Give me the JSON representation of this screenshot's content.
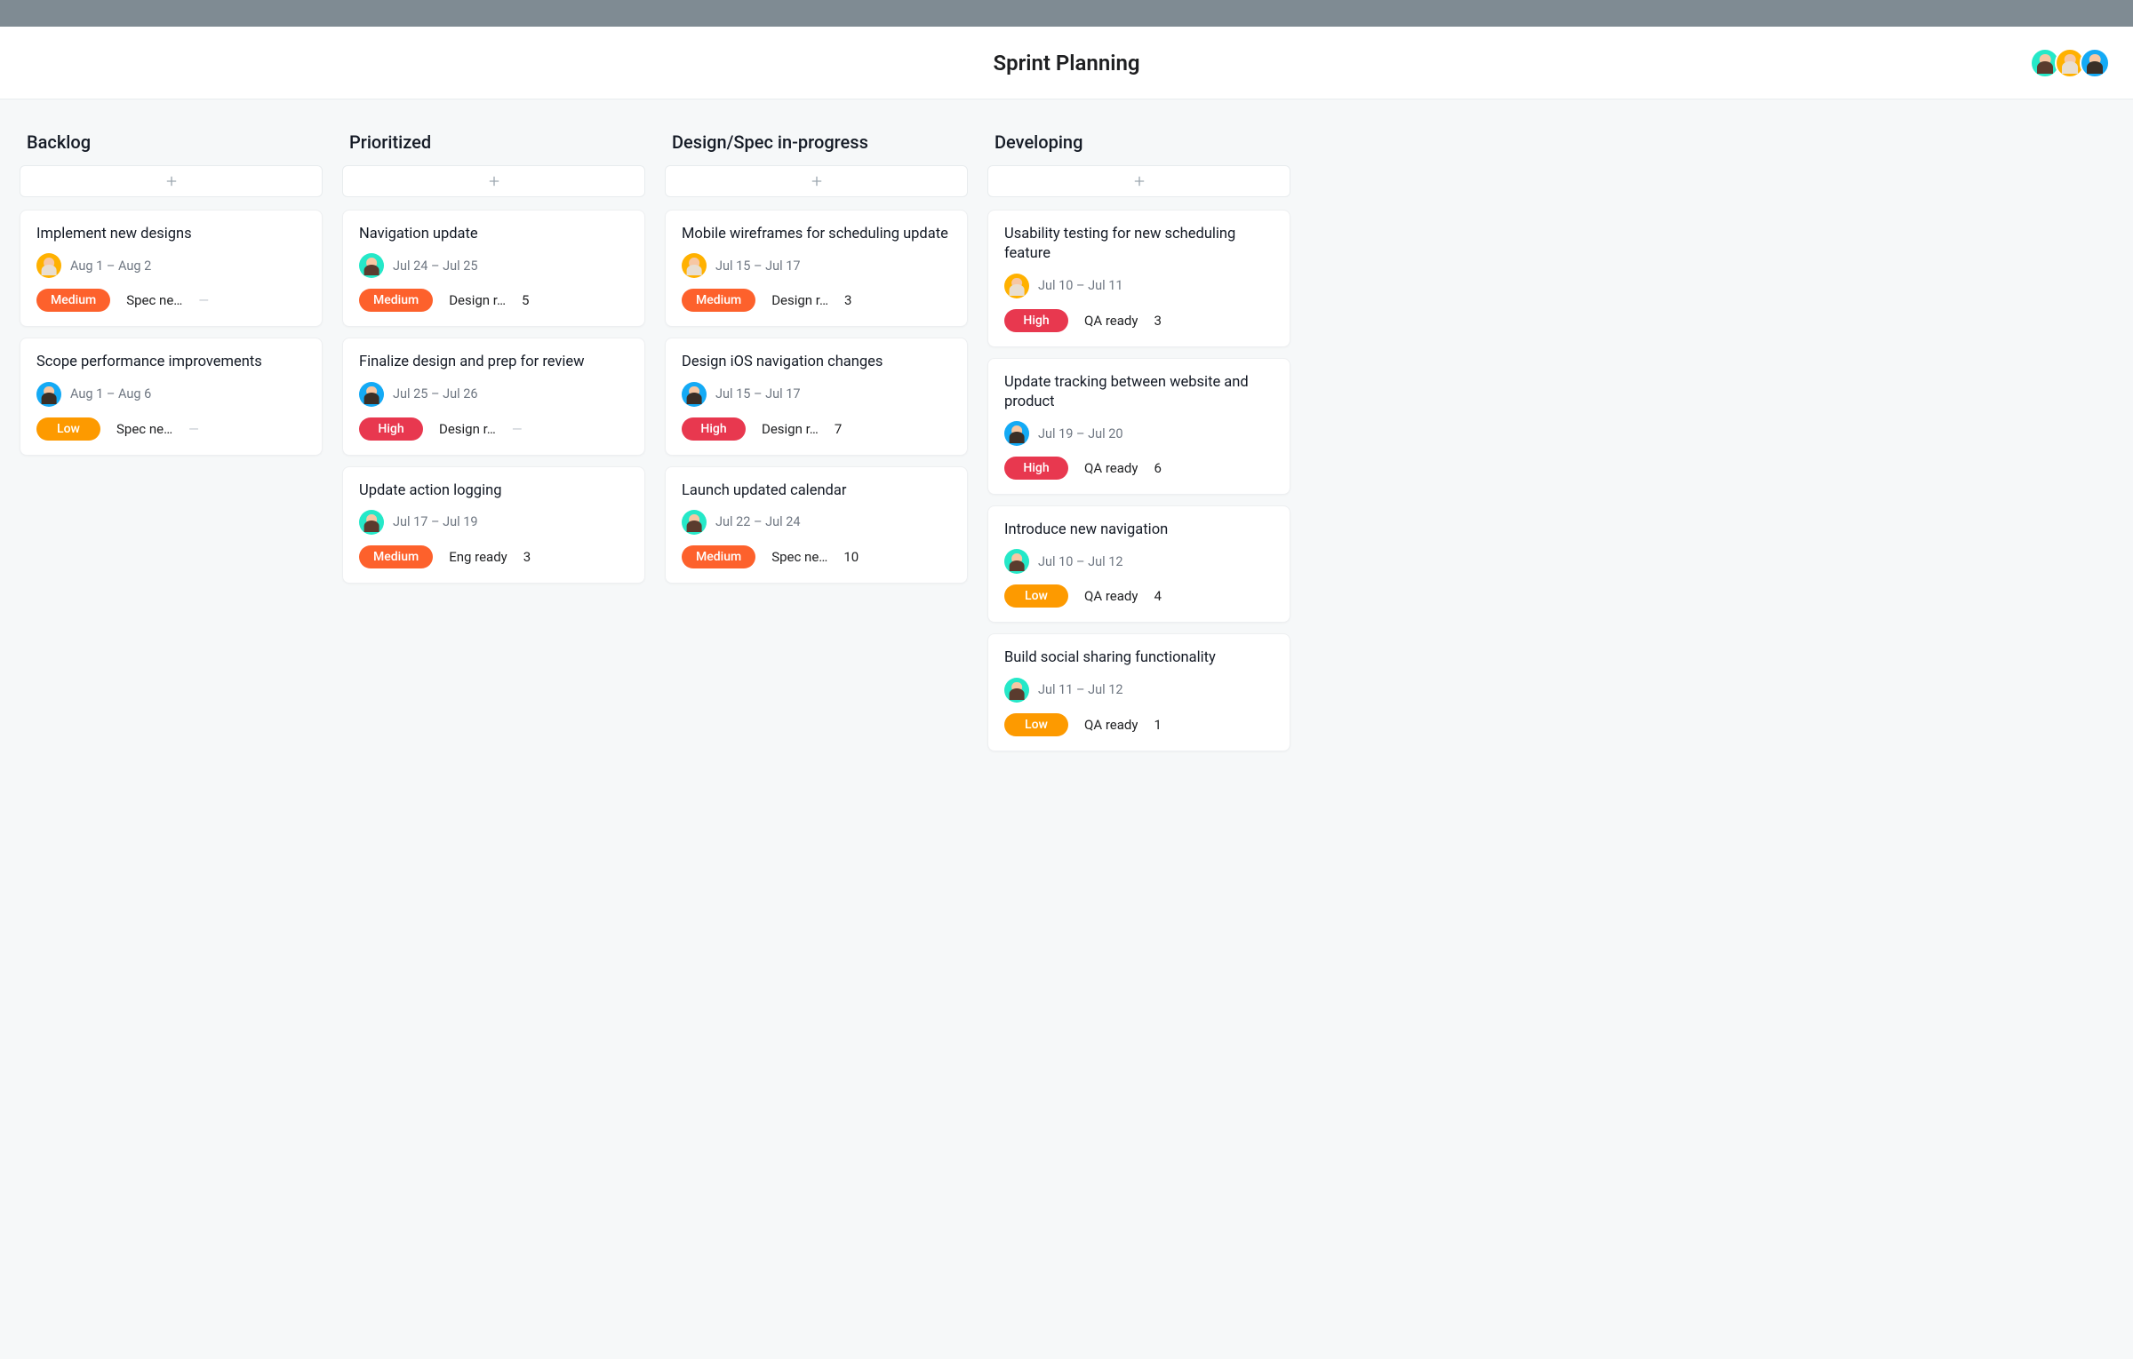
{
  "header": {
    "title": "Sprint Planning",
    "avatars": [
      "green",
      "yellow",
      "cyan"
    ]
  },
  "priority_labels": {
    "medium": "Medium",
    "high": "High",
    "low": "Low"
  },
  "columns": [
    {
      "title": "Backlog",
      "cards": [
        {
          "title": "Implement new designs",
          "avatar": "yellow",
          "dates": "Aug 1 – Aug 2",
          "priority": "medium",
          "status": "Spec ne…",
          "count": null
        },
        {
          "title": "Scope performance improvements",
          "avatar": "cyan",
          "dates": "Aug 1 – Aug 6",
          "priority": "low",
          "status": "Spec ne…",
          "count": null
        }
      ]
    },
    {
      "title": "Prioritized",
      "cards": [
        {
          "title": "Navigation update",
          "avatar": "green",
          "dates": "Jul 24 – Jul 25",
          "priority": "medium",
          "status": "Design r…",
          "count": 5
        },
        {
          "title": "Finalize design and prep for review",
          "avatar": "cyan",
          "dates": "Jul 25 – Jul 26",
          "priority": "high",
          "status": "Design r…",
          "count": null
        },
        {
          "title": "Update action logging",
          "avatar": "green",
          "dates": "Jul 17 – Jul 19",
          "priority": "medium",
          "status": "Eng ready",
          "count": 3
        }
      ]
    },
    {
      "title": "Design/Spec in-progress",
      "cards": [
        {
          "title": "Mobile wireframes for scheduling update",
          "avatar": "yellow",
          "dates": "Jul 15 – Jul 17",
          "priority": "medium",
          "status": "Design r…",
          "count": 3
        },
        {
          "title": "Design iOS navigation changes",
          "avatar": "cyan",
          "dates": "Jul 15 – Jul 17",
          "priority": "high",
          "status": "Design r…",
          "count": 7
        },
        {
          "title": "Launch updated calendar",
          "avatar": "green",
          "dates": "Jul 22 – Jul 24",
          "priority": "medium",
          "status": "Spec ne…",
          "count": 10
        }
      ]
    },
    {
      "title": "Developing",
      "cards": [
        {
          "title": "Usability testing for new scheduling feature",
          "avatar": "yellow",
          "dates": "Jul 10 – Jul 11",
          "priority": "high",
          "status": "QA ready",
          "count": 3
        },
        {
          "title": "Update tracking between website and product",
          "avatar": "cyan",
          "dates": "Jul 19 – Jul 20",
          "priority": "high",
          "status": "QA ready",
          "count": 6
        },
        {
          "title": "Introduce new navigation",
          "avatar": "green",
          "dates": "Jul 10 – Jul 12",
          "priority": "low",
          "status": "QA ready",
          "count": 4
        },
        {
          "title": "Build social sharing functionality",
          "avatar": "green",
          "dates": "Jul 11 – Jul 12",
          "priority": "low",
          "status": "QA ready",
          "count": 1
        }
      ]
    }
  ]
}
